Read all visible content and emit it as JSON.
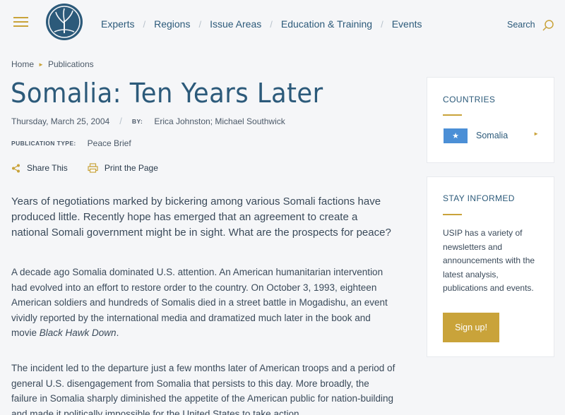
{
  "header": {
    "nav": [
      "Experts",
      "Regions",
      "Issue Areas",
      "Education & Training",
      "Events"
    ],
    "search_label": "Search"
  },
  "breadcrumb": {
    "home": "Home",
    "current": "Publications"
  },
  "article": {
    "title": "Somalia: Ten Years Later",
    "date": "Thursday, March 25, 2004",
    "by_label": "BY:",
    "authors": "Erica Johnston; Michael Southwick",
    "pubtype_label": "PUBLICATION TYPE:",
    "pubtype": "Peace Brief",
    "share_label": "Share This",
    "print_label": "Print the Page",
    "lede": "Years of negotiations marked by bickering among various Somali factions have produced little. Recently hope has emerged that an agreement to create a national Somali government might be in sight. What are the prospects for peace?",
    "p1_text": "A decade ago Somalia dominated U.S. attention. An American humanitarian intervention had evolved into an effort to restore order to the country. On October 3, 1993, eighteen American soldiers and hundreds of Somalis died in a street battle in Mogadishu, an event vividly reported by the international media and dramatized much later in the book and movie ",
    "p1_italic": "Black Hawk Down",
    "p1_end": ".",
    "p2": "The incident led to the departure just a few months later of American troops and a period of general U.S. disengagement from Somalia that persists to this day. More broadly, the failure in Somalia sharply diminished the appetite of the American public for nation-building and made it politically impossible for the United States to take action"
  },
  "sidebar": {
    "countries_heading": "COUNTRIES",
    "country": "Somalia",
    "stay_heading": "STAY INFORMED",
    "stay_text": "USIP has a variety of newsletters and announcements with the latest analysis, publications and events.",
    "signup_label": "Sign up!"
  },
  "colors": {
    "accent": "#c9a33a",
    "brand": "#2c5a7a",
    "flag": "#4b8fd6"
  }
}
